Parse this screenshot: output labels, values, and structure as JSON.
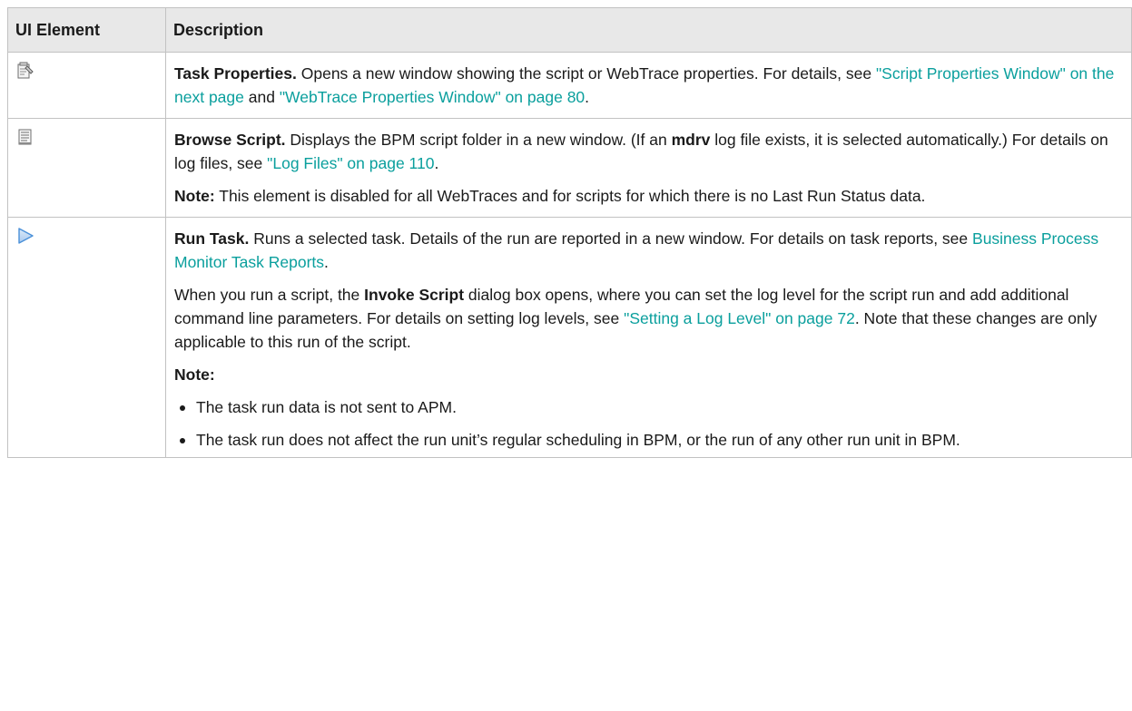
{
  "header": {
    "col1": "UI Element",
    "col2": "Description"
  },
  "rows": [
    {
      "icon": "task-properties-icon",
      "title": "Task Properties.",
      "t1": " Opens a new window showing the script or WebTrace properties. For details, see ",
      "link1": "\"Script Properties Window\" on the next page",
      "t2": " and ",
      "link2": "\"WebTrace Properties Window\" on page 80",
      "t3": "."
    },
    {
      "icon": "browse-script-icon",
      "title": "Browse Script.",
      "t1": " Displays the BPM script folder in a new window. (If an ",
      "bold1": "mdrv",
      "t2": " log file exists, it is selected automatically.) For details on log files, see ",
      "link1": "\"Log Files\" on page 110",
      "t3": ".",
      "note_label": "Note:",
      "note_text": " This element is disabled for all WebTraces and for scripts for which there is no Last Run Status data."
    },
    {
      "icon": "run-task-icon",
      "title": "Run Task.",
      "t1": " Runs a selected task. Details of the run are reported in a new window. For details on task reports, see ",
      "link1": "Business Process Monitor Task Reports",
      "t2": ".",
      "p2_a": "When you run a script, the ",
      "p2_bold": "Invoke Script",
      "p2_b": " dialog box opens, where you can set the log level for the script run and add additional command line parameters. For details on setting log levels, see ",
      "p2_link": "\"Setting a Log Level\" on page 72",
      "p2_c": ". Note that these changes are only applicable to this run of the script.",
      "note_label": "Note:",
      "bullets": [
        "The task run data is not sent to APM.",
        "The task run does not affect the run unit’s regular scheduling in BPM, or the run of any other run unit in BPM."
      ]
    }
  ],
  "colors": {
    "link": "#0a9f9d",
    "header_bg": "#e8e8e8",
    "border": "#c2c2c2",
    "run_icon": "#4a90d9"
  }
}
